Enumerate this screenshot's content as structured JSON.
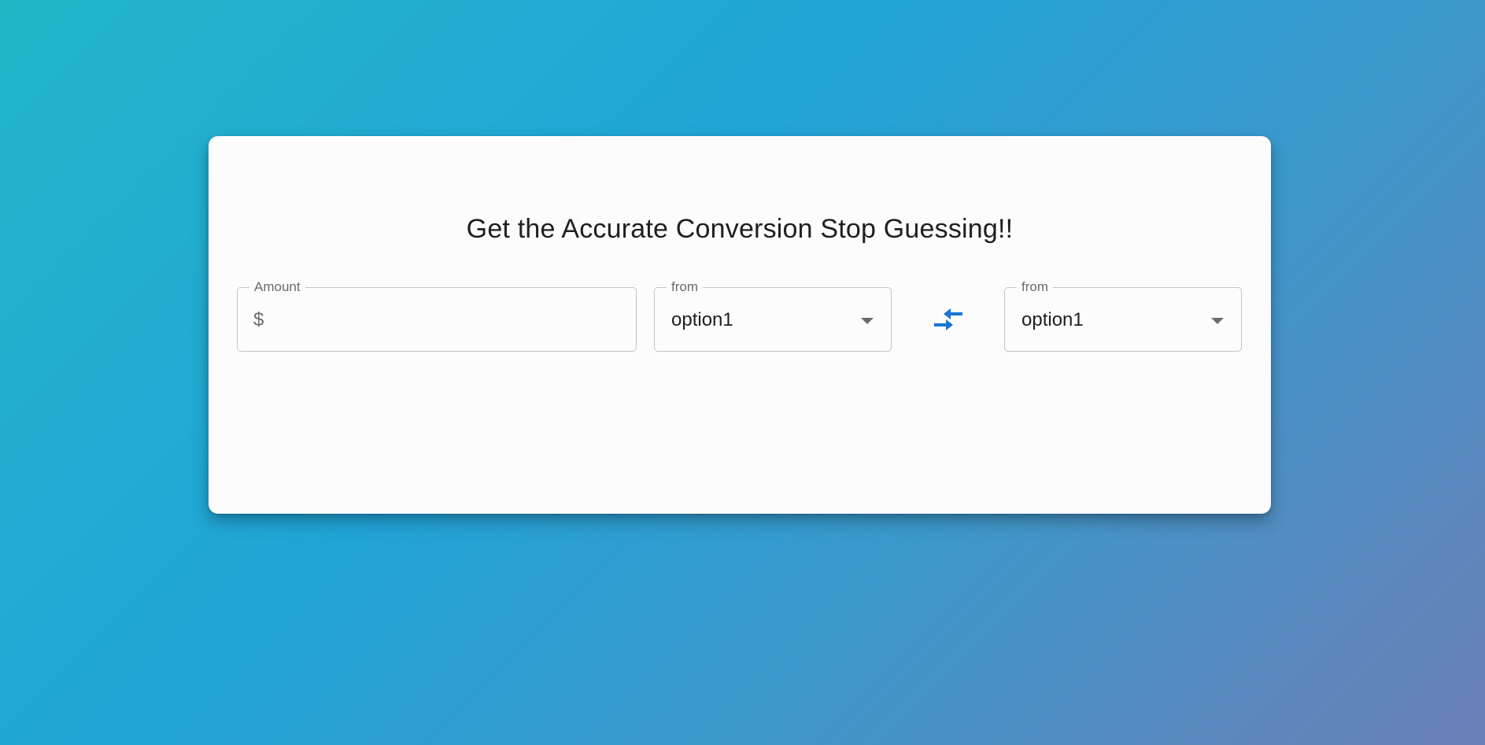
{
  "card": {
    "title": "Get the Accurate Conversion Stop Guessing!!"
  },
  "amount": {
    "label": "Amount",
    "prefix": "$",
    "value": ""
  },
  "from_select": {
    "label": "from",
    "value": "option1"
  },
  "to_select": {
    "label": "from",
    "value": "option1"
  },
  "icons": {
    "swap": "compare-arrows-icon",
    "dropdown": "arrow-drop-down-icon"
  },
  "colors": {
    "accent": "#1976d2",
    "card_bg": "#fcfcfd",
    "text": "#1f1f1f",
    "muted": "#6b6b6b",
    "border": "#c4c4c4"
  }
}
